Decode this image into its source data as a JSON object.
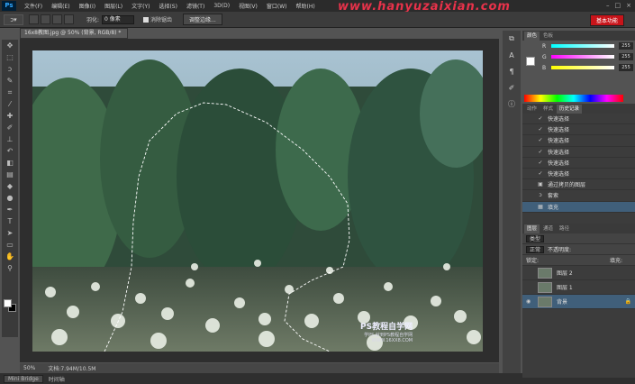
{
  "app": {
    "logo": "Ps",
    "watermark": "www.hanyuzaixian.com"
  },
  "menu": [
    "文件(F)",
    "编辑(E)",
    "图像(I)",
    "图层(L)",
    "文字(Y)",
    "选择(S)",
    "滤镜(T)",
    "3D(D)",
    "视图(V)",
    "窗口(W)",
    "帮助(H)"
  ],
  "window_controls": [
    "–",
    "□",
    "×"
  ],
  "options": {
    "tool_icon": "lasso-icon",
    "feather_label": "羽化:",
    "feather_value": "0 像素",
    "antialias_label": "消除锯齿",
    "refine_btn": "调整边缘...",
    "essentials": "基本功能"
  },
  "document": {
    "tab": "16x8教图.jpg @ 50% (背景, RGB/8) *",
    "zoom": "50%",
    "docsize": "文档:7.94M/10.5M"
  },
  "bottom": {
    "mini_bridge": "Mini Bridge",
    "timeline": "时间轴"
  },
  "panels": {
    "color_tabs": [
      "颜色",
      "色板"
    ],
    "rgb": [
      {
        "l": "R",
        "v": "255"
      },
      {
        "l": "G",
        "v": "255"
      },
      {
        "l": "B",
        "v": "255"
      }
    ],
    "history_tabs": [
      "动作",
      "样式",
      "历史记录"
    ],
    "history": [
      {
        "icon": "brush-icon",
        "label": "快速选择"
      },
      {
        "icon": "brush-icon",
        "label": "快速选择"
      },
      {
        "icon": "brush-icon",
        "label": "快速选择"
      },
      {
        "icon": "brush-icon",
        "label": "快速选择"
      },
      {
        "icon": "brush-icon",
        "label": "快速选择"
      },
      {
        "icon": "brush-icon",
        "label": "快速选择"
      },
      {
        "icon": "layer-icon",
        "label": "通过拷贝的图层"
      },
      {
        "icon": "lasso-icon",
        "label": "套索"
      },
      {
        "icon": "fill-icon",
        "label": "填充"
      }
    ],
    "layer_tabs": [
      "图层",
      "通道",
      "路径"
    ],
    "kind": "类型",
    "blend": "正常",
    "opacity": "不透明度:",
    "lock": "锁定:",
    "fill": "填充:",
    "layers": [
      {
        "name": "图层 2",
        "selected": false
      },
      {
        "name": "图层 1",
        "selected": false
      },
      {
        "name": "背景",
        "selected": true
      }
    ]
  },
  "photo_watermark": {
    "line1": "PS教程自学网",
    "line2": "学PS,就到PS教程自学网",
    "line3": "WWW.16XX8.COM"
  }
}
